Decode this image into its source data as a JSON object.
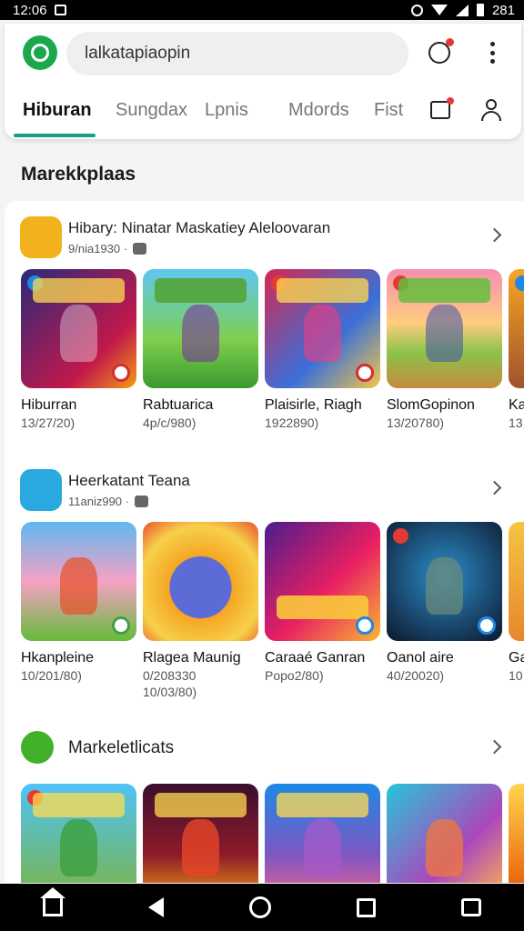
{
  "status_bar": {
    "time": "12:06",
    "battery": "281"
  },
  "search": {
    "value": "lalkatapiaopin"
  },
  "tabs": [
    "Hiburan",
    "Sungdax",
    "Lpnis",
    "Mdords",
    "Fist"
  ],
  "page_title": "Marekkplaas",
  "sections": [
    {
      "title": "Hibary: Ninatar  Maskatiey  Aleloovaran",
      "meta": "9/nia1930 ·",
      "apps": [
        {
          "name": "Hiburran",
          "sub": "13/27/20)"
        },
        {
          "name": "Rabtuarica",
          "sub": "4p/c/980)"
        },
        {
          "name": "Plaisirle, Riagh",
          "sub": "1922890)"
        },
        {
          "name": "SlomGopinon",
          "sub": "13/20780)"
        },
        {
          "name": "Ka",
          "sub": "13"
        }
      ]
    },
    {
      "title": "Heerkatant Teana",
      "meta": "11aniz990 ·",
      "apps": [
        {
          "name": "Hkanpleine",
          "sub": "10/201/80)",
          "sub2": ""
        },
        {
          "name": "Rlagea Maunig",
          "sub": "0/208330",
          "sub2": "10/03/80)"
        },
        {
          "name": "Caraaé Ganran",
          "sub": "Popo2/80)",
          "sub2": ""
        },
        {
          "name": "Oanol aire",
          "sub": "40/20020)",
          "sub2": ""
        },
        {
          "name": "Ga",
          "sub": "10",
          "sub2": ""
        }
      ]
    },
    {
      "title": "Markeletlicats",
      "meta": "",
      "apps": [
        {
          "name": "",
          "sub": ""
        },
        {
          "name": "",
          "sub": ""
        },
        {
          "name": "",
          "sub": ""
        },
        {
          "name": "",
          "sub": ""
        },
        {
          "name": "",
          "sub": ""
        }
      ]
    }
  ],
  "colors": {
    "accent": "#16a086",
    "brand": "#1aa84a"
  }
}
